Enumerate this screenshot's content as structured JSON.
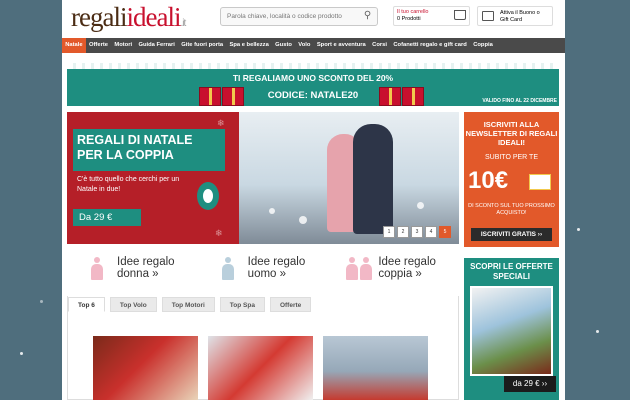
{
  "header": {
    "logo_part1": "regali",
    "logo_part2": "ideali",
    "logo_tld": ".it",
    "search_placeholder": "Parola chiave, località o codice prodotto",
    "cart_label": "Il tuo carrello",
    "cart_count": "0 Prodotti",
    "gift_label_line1": "Attiva il Buono o",
    "gift_label_line2": "Gift Card"
  },
  "nav": [
    "Natale",
    "Offerte",
    "Motori",
    "Guida Ferrari",
    "Gite fuori porta",
    "Spa e bellezza",
    "Gusto",
    "Volo",
    "Sport e avventura",
    "Corsi",
    "Cofanetti regalo e gift card",
    "Coppia"
  ],
  "promo": {
    "line1": "TI REGALIAMO UNO SCONTO DEL 20%",
    "line2": "CODICE: NATALE20",
    "valid": "VALIDO FINO AL 22 DICEMBRE"
  },
  "hero": {
    "title": "REGALI DI NATALE PER LA COPPIA",
    "desc": "C'è tutto quello che cerchi per un Natale in due!",
    "price": "Da 29 €",
    "pager": [
      "1",
      "2",
      "3",
      "4",
      "5"
    ]
  },
  "ideas": [
    {
      "line1": "Idee regalo",
      "line2": "donna »"
    },
    {
      "line1": "Idee regalo",
      "line2": "uomo »"
    },
    {
      "line1": "Idee regalo",
      "line2": "coppia »"
    }
  ],
  "tabs": [
    "Top 6",
    "Top Volo",
    "Top Motori",
    "Top Spa",
    "Offerte"
  ],
  "newsletter": {
    "title": "ISCRIVITI ALLA NEWSLETTER DI REGALI IDEALI!",
    "subtitle": "SUBITO PER TE",
    "price": "10€",
    "desc": "DI SCONTO SUL TUO PROSSIMO ACQUISTO!",
    "button": "ISCRIVITI GRATIS ››"
  },
  "offers": {
    "title": "SCOPRI LE OFFERTE SPECIALI",
    "price": "da 29 € ››"
  },
  "colors": {
    "accent": "#e2592a",
    "teal": "#1e8e80",
    "red": "#b51f28",
    "nav_bg": "#4a4a4a",
    "body_bg": "#4f6e7d"
  }
}
